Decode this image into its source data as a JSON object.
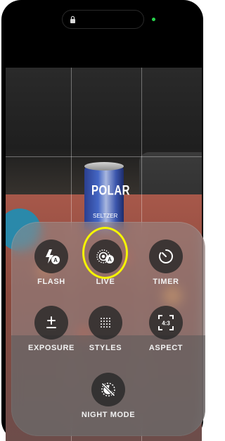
{
  "status": {
    "camera_indicator_color": "#27d34c",
    "lock_icon": "lock-icon"
  },
  "viewfinder": {
    "can_brand": "POLAR",
    "can_sub": "SELTZER"
  },
  "controls": [
    {
      "id": "flash",
      "label": "FLASH",
      "icon": "flash-auto-icon"
    },
    {
      "id": "live",
      "label": "LIVE",
      "icon": "live-photo-auto-icon"
    },
    {
      "id": "timer",
      "label": "TIMER",
      "icon": "timer-icon"
    },
    {
      "id": "exposure",
      "label": "EXPOSURE",
      "icon": "exposure-icon"
    },
    {
      "id": "styles",
      "label": "STYLES",
      "icon": "styles-icon"
    },
    {
      "id": "aspect",
      "label": "ASPECT",
      "icon": "aspect-ratio-icon"
    },
    {
      "id": "night",
      "label": "NIGHT MODE",
      "icon": "night-mode-off-icon"
    }
  ],
  "aspect_ratio_value": "4:3",
  "highlight_color": "#f5f500"
}
